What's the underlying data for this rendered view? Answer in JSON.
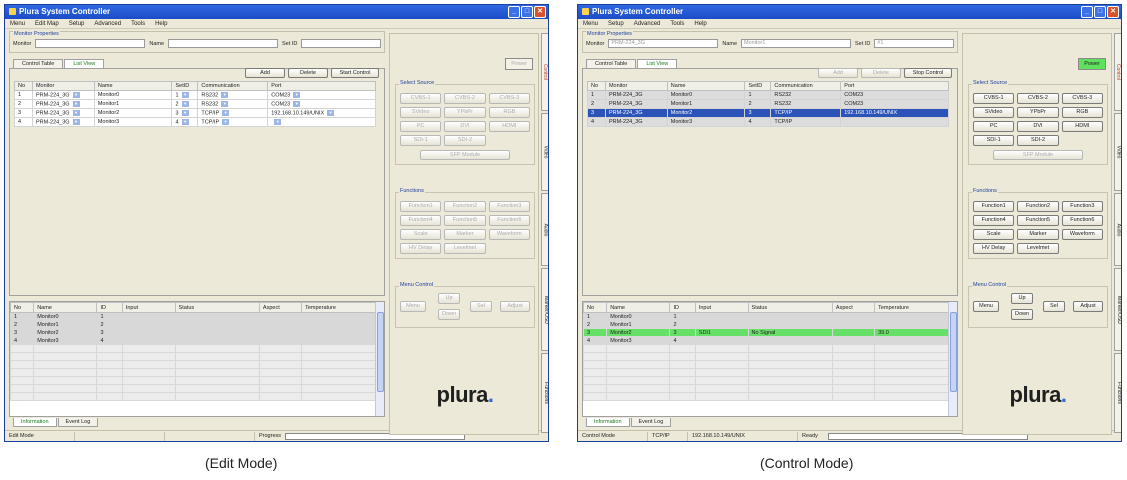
{
  "edit": {
    "title": "Plura System Controller",
    "menu": [
      "Menu",
      "Edit Map",
      "Setup",
      "Advanced",
      "Tools",
      "Help"
    ],
    "props_title": "Monitor Properties",
    "props": {
      "monitor_label": "Monitor",
      "name_label": "Name",
      "setid_label": "Set ID"
    },
    "tabs": [
      "Control Table",
      "List View"
    ],
    "buttons": {
      "add": "Add",
      "delete": "Delete",
      "mode": "Start Control"
    },
    "columns": [
      "No",
      "Monitor",
      "Name",
      "SetID",
      "Communication",
      "Port"
    ],
    "rows": [
      {
        "no": "1",
        "monitor": "PRM-224_3G",
        "name": "Monitor0",
        "setid": "1",
        "comm": "RS232",
        "port": "COM23"
      },
      {
        "no": "2",
        "monitor": "PRM-224_3G",
        "name": "Monitor1",
        "setid": "2",
        "comm": "RS232",
        "port": "COM23"
      },
      {
        "no": "3",
        "monitor": "PRM-224_3G",
        "name": "Monitor2",
        "setid": "3",
        "comm": "TCP/IP",
        "port": "192.168.10.149/UNIX"
      },
      {
        "no": "4",
        "monitor": "PRM-224_3G",
        "name": "Monitor3",
        "setid": "4",
        "comm": "TCP/IP",
        "port": ""
      }
    ],
    "status_columns": [
      "No",
      "Name",
      "ID",
      "Input",
      "Status",
      "Aspect",
      "Temperature"
    ],
    "status_rows": [
      {
        "no": "1",
        "name": "Monitor0",
        "id": "1"
      },
      {
        "no": "2",
        "name": "Monitor1",
        "id": "2"
      },
      {
        "no": "3",
        "name": "Monitor2",
        "id": "3"
      },
      {
        "no": "4",
        "name": "Monitor3",
        "id": "4"
      }
    ],
    "bottom_tabs": [
      "Information",
      "Event Log"
    ],
    "statusbar": {
      "mode": "Edit Mode",
      "progress_label": "Progress"
    },
    "power": "Power",
    "select_source_title": "Select Source",
    "sources": [
      "CVBS-1",
      "CVBS-2",
      "CVBS-3",
      "SVideo",
      "YPbPr",
      "RGB",
      "PC",
      "DVI",
      "HDMI",
      "SDI-1",
      "SDI-2"
    ],
    "sfp": "SFP Module",
    "functions_title": "Functions",
    "functions": [
      "Function1",
      "Function2",
      "Function3",
      "Function4",
      "Function5",
      "Function6",
      "Scale",
      "Marker",
      "Waveform",
      "HV Delay",
      "Levelmet"
    ],
    "menu_control_title": "Menu Control",
    "menu_btns": {
      "menu": "Menu",
      "up": "Up",
      "down": "Down",
      "sel": "Sel",
      "adjust": "Adjust"
    },
    "logo": "plura",
    "vtabs": [
      "Control",
      "Video",
      "Audio",
      "Marker/OSD",
      "Functions"
    ]
  },
  "control": {
    "title": "Plura System Controller",
    "menu": [
      "Menu",
      "Setup",
      "Advanced",
      "Tools",
      "Help"
    ],
    "props_title": "Monitor Properties",
    "props": {
      "monitor_label": "Monitor",
      "monitor_value": "PRM-224_3G",
      "name_label": "Name",
      "name_value": "Monitor1",
      "setid_label": "Set ID",
      "setid_value": "#1"
    },
    "tabs": [
      "Control Table",
      "List View"
    ],
    "buttons": {
      "add": "Add",
      "delete": "Delete",
      "mode": "Stop Control"
    },
    "columns": [
      "No",
      "Monitor",
      "Name",
      "SetID",
      "Communication",
      "Port"
    ],
    "rows": [
      {
        "no": "1",
        "monitor": "PRM-224_3G",
        "name": "Monitor0",
        "setid": "1",
        "comm": "RS232",
        "port": "COM23"
      },
      {
        "no": "2",
        "monitor": "PRM-224_3G",
        "name": "Monitor1",
        "setid": "2",
        "comm": "RS232",
        "port": "COM23"
      },
      {
        "no": "3",
        "monitor": "PRM-224_3G",
        "name": "Monitor2",
        "setid": "3",
        "comm": "TCP/IP",
        "port": "192.168.10.149/UNIX"
      },
      {
        "no": "4",
        "monitor": "PRM-224_3G",
        "name": "Monitor3",
        "setid": "4",
        "comm": "TCP/IP",
        "port": ""
      }
    ],
    "status_columns": [
      "No",
      "Name",
      "ID",
      "Input",
      "Status",
      "Aspect",
      "Temperature"
    ],
    "status_rows": [
      {
        "no": "1",
        "name": "Monitor0",
        "id": "1",
        "input": "",
        "status": "",
        "temp": ""
      },
      {
        "no": "2",
        "name": "Monitor1",
        "id": "2",
        "input": "",
        "status": "",
        "temp": ""
      },
      {
        "no": "3",
        "name": "Monitor2",
        "id": "3",
        "input": "SDI1",
        "status": "No Signal",
        "temp": "39.0"
      },
      {
        "no": "4",
        "name": "Monitor3",
        "id": "4",
        "input": "",
        "status": "",
        "temp": ""
      }
    ],
    "bottom_tabs": [
      "Information",
      "Event Log"
    ],
    "statusbar": {
      "mode": "Control Mode",
      "comm": "TCP/IP",
      "ip": "192.168.10.149/UNIX",
      "state": "Ready"
    },
    "power": "Power",
    "select_source_title": "Select Source",
    "sources": [
      "CVBS-1",
      "CVBS-2",
      "CVBS-3",
      "SVideo",
      "YPbPr",
      "RGB",
      "PC",
      "DVI",
      "HDMI",
      "SDI-1",
      "SDI-2"
    ],
    "sfp": "SFP Module",
    "functions_title": "Functions",
    "functions": [
      "Function1",
      "Function2",
      "Function3",
      "Function4",
      "Function5",
      "Function6",
      "Scale",
      "Marker",
      "Waveform",
      "HV Delay",
      "Levelmet"
    ],
    "menu_control_title": "Menu Control",
    "menu_btns": {
      "menu": "Menu",
      "up": "Up",
      "down": "Down",
      "sel": "Sel",
      "adjust": "Adjust"
    },
    "logo": "plura",
    "vtabs": [
      "Control",
      "Video",
      "Audio",
      "Marker/OSD",
      "Functions"
    ]
  },
  "captions": {
    "left": "(Edit Mode)",
    "right": "(Control Mode)"
  },
  "colors": {
    "selected_row": "#2c53b8",
    "status_ok": "#66e066",
    "power_on": "#5fe05f"
  }
}
